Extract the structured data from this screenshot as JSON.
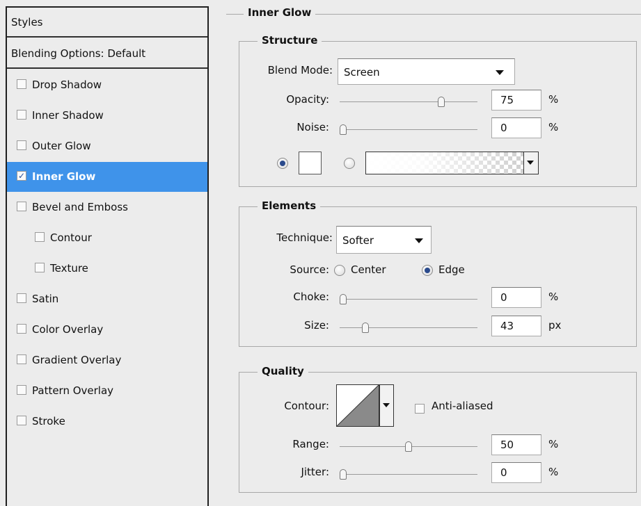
{
  "styles_panel": {
    "header": "Styles",
    "blending_options": "Blending Options: Default",
    "items": [
      {
        "label": "Drop Shadow",
        "checked": false,
        "sub": false,
        "selected": false
      },
      {
        "label": "Inner Shadow",
        "checked": false,
        "sub": false,
        "selected": false
      },
      {
        "label": "Outer Glow",
        "checked": false,
        "sub": false,
        "selected": false
      },
      {
        "label": "Inner Glow",
        "checked": true,
        "sub": false,
        "selected": true
      },
      {
        "label": "Bevel and Emboss",
        "checked": false,
        "sub": false,
        "selected": false
      },
      {
        "label": "Contour",
        "checked": false,
        "sub": true,
        "selected": false
      },
      {
        "label": "Texture",
        "checked": false,
        "sub": true,
        "selected": false
      },
      {
        "label": "Satin",
        "checked": false,
        "sub": false,
        "selected": false
      },
      {
        "label": "Color Overlay",
        "checked": false,
        "sub": false,
        "selected": false
      },
      {
        "label": "Gradient Overlay",
        "checked": false,
        "sub": false,
        "selected": false
      },
      {
        "label": "Pattern Overlay",
        "checked": false,
        "sub": false,
        "selected": false
      },
      {
        "label": "Stroke",
        "checked": false,
        "sub": false,
        "selected": false
      }
    ]
  },
  "inner_glow": {
    "title": "Inner Glow",
    "structure": {
      "title": "Structure",
      "blend_mode_label": "Blend Mode:",
      "blend_mode_value": "Screen",
      "opacity_label": "Opacity:",
      "opacity_value": "75",
      "opacity_unit": "%",
      "opacity_level": 0.75,
      "noise_label": "Noise:",
      "noise_value": "0",
      "noise_unit": "%",
      "noise_level": 0,
      "color_mode": "solid",
      "color_swatch": "#ffffff"
    },
    "elements": {
      "title": "Elements",
      "technique_label": "Technique:",
      "technique_value": "Softer",
      "source_label": "Source:",
      "source_center": "Center",
      "source_edge": "Edge",
      "source_selected": "Edge",
      "choke_label": "Choke:",
      "choke_value": "0",
      "choke_unit": "%",
      "choke_level": 0,
      "size_label": "Size:",
      "size_value": "43",
      "size_unit": "px",
      "size_level": 0.17
    },
    "quality": {
      "title": "Quality",
      "contour_label": "Contour:",
      "anti_aliased_label": "Anti-aliased",
      "anti_aliased_checked": false,
      "range_label": "Range:",
      "range_value": "50",
      "range_unit": "%",
      "range_level": 0.5,
      "jitter_label": "Jitter:",
      "jitter_value": "0",
      "jitter_unit": "%",
      "jitter_level": 0
    }
  },
  "colors": {
    "selection": "#3f93ea",
    "panel_bg": "#ececec"
  }
}
